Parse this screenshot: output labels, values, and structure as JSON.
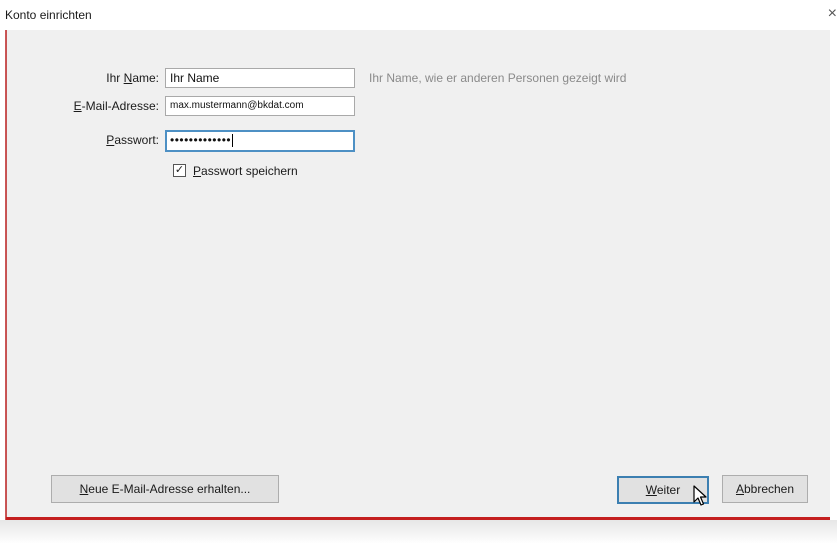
{
  "window": {
    "title": "Konto einrichten",
    "close_glyph": "×"
  },
  "form": {
    "name": {
      "label_pre": "Ihr ",
      "label_accel": "N",
      "label_post": "ame:",
      "value": "Ihr Name",
      "hint": "Ihr Name, wie er anderen Personen gezeigt wird"
    },
    "email": {
      "label_accel": "E",
      "label_post": "-Mail-Adresse:",
      "value": "max.mustermann@bkdat.com"
    },
    "password": {
      "label_accel": "P",
      "label_post": "asswort:",
      "value": "•••••••••••••"
    },
    "remember": {
      "checked_glyph": "✓",
      "label_accel": "P",
      "label_post": "asswort speichern"
    }
  },
  "buttons": {
    "new_address": {
      "label_accel": "N",
      "label_post": "eue E-Mail-Adresse erhalten..."
    },
    "next": {
      "label_accel": "W",
      "label_post": "eiter"
    },
    "cancel": {
      "label_accel": "A",
      "label_post": "bbrechen"
    }
  },
  "colors": {
    "accent_red": "#c41f1f",
    "focus_blue": "#4d90c4",
    "dialog_background": "#f0f0f0"
  },
  "icons": {
    "close": "close-icon",
    "check": "checkmark-icon",
    "pointer": "mouse-pointer-icon"
  }
}
